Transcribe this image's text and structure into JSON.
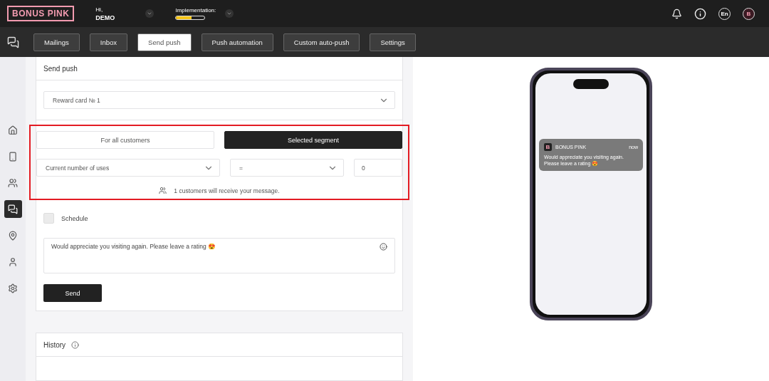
{
  "header": {
    "logo": "BONUS PINK",
    "greeting": "Hi,",
    "user": "DEMO",
    "implementation": {
      "label": "Implementation:",
      "level": 0.55
    },
    "language": "En",
    "avatar": "B"
  },
  "tabs": [
    {
      "label": "Mailings",
      "selected": false
    },
    {
      "label": "Inbox",
      "selected": false
    },
    {
      "label": "Send push",
      "selected": true
    },
    {
      "label": "Push automation",
      "selected": false
    },
    {
      "label": "Custom auto-push",
      "selected": false
    },
    {
      "label": "Settings",
      "selected": false
    }
  ],
  "sidebar": {
    "items": [
      {
        "kind": "home",
        "selected": false
      },
      {
        "kind": "terminal",
        "selected": false
      },
      {
        "kind": "users",
        "selected": false
      },
      {
        "kind": "chat",
        "selected": true
      },
      {
        "kind": "pin",
        "selected": false
      },
      {
        "kind": "user",
        "selected": false
      },
      {
        "kind": "settings",
        "selected": false
      }
    ]
  },
  "send_push": {
    "title": "Send push",
    "card_select": "Reward card № 1",
    "audience": [
      {
        "label": "For all customers",
        "selected": false
      },
      {
        "label": "Selected segment",
        "selected": true
      }
    ],
    "condition": {
      "field": "Current number of uses",
      "operator": "=",
      "value": "0"
    },
    "recipients_note": "1 customers will receive your message.",
    "schedule": {
      "label": "Schedule",
      "checked": false
    },
    "message": "Would appreciate you visiting again. Please leave a rating 😍",
    "send_button": "Send"
  },
  "history": {
    "title": "History"
  },
  "preview": {
    "app_name": "BONUS PINK",
    "app_initial": "B",
    "time": "now",
    "message": "Would appreciate you visiting again. Please leave a rating 😍"
  }
}
